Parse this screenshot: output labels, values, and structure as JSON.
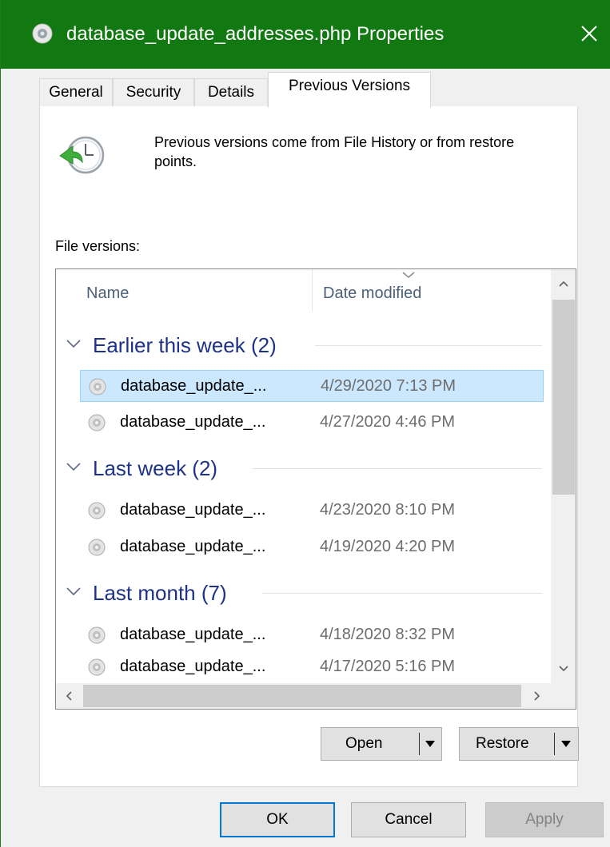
{
  "window": {
    "title": "database_update_addresses.php Properties"
  },
  "tabs": [
    {
      "label": "General"
    },
    {
      "label": "Security"
    },
    {
      "label": "Details"
    },
    {
      "label": "Previous Versions",
      "active": true
    }
  ],
  "info": {
    "text": "Previous versions come from File History or from restore points."
  },
  "versions": {
    "label": "File versions:",
    "columns": {
      "name": "Name",
      "date": "Date modified"
    },
    "groups": [
      {
        "label": "Earlier this week (2)",
        "rows": [
          {
            "name": "database_update_...",
            "date": "4/29/2020 7:13 PM",
            "selected": true
          },
          {
            "name": "database_update_...",
            "date": "4/27/2020 4:46 PM"
          }
        ]
      },
      {
        "label": "Last week (2)",
        "rows": [
          {
            "name": "database_update_...",
            "date": "4/23/2020 8:10 PM"
          },
          {
            "name": "database_update_...",
            "date": "4/19/2020 4:20 PM"
          }
        ]
      },
      {
        "label": "Last month (7)",
        "rows": [
          {
            "name": "database_update_...",
            "date": "4/18/2020 8:32 PM"
          },
          {
            "name": "database_update_...",
            "date": "4/17/2020 5:16 PM"
          }
        ]
      }
    ]
  },
  "actions": {
    "open": "Open",
    "restore": "Restore"
  },
  "buttons": {
    "ok": "OK",
    "cancel": "Cancel",
    "apply": "Apply"
  },
  "colors": {
    "titlebar": "#127812",
    "group_header": "#1e3287",
    "selection": "#cce8ff"
  },
  "icons": {
    "title": "php-file-icon",
    "history": "file-history-clock-icon",
    "row": "file-version-icon"
  }
}
